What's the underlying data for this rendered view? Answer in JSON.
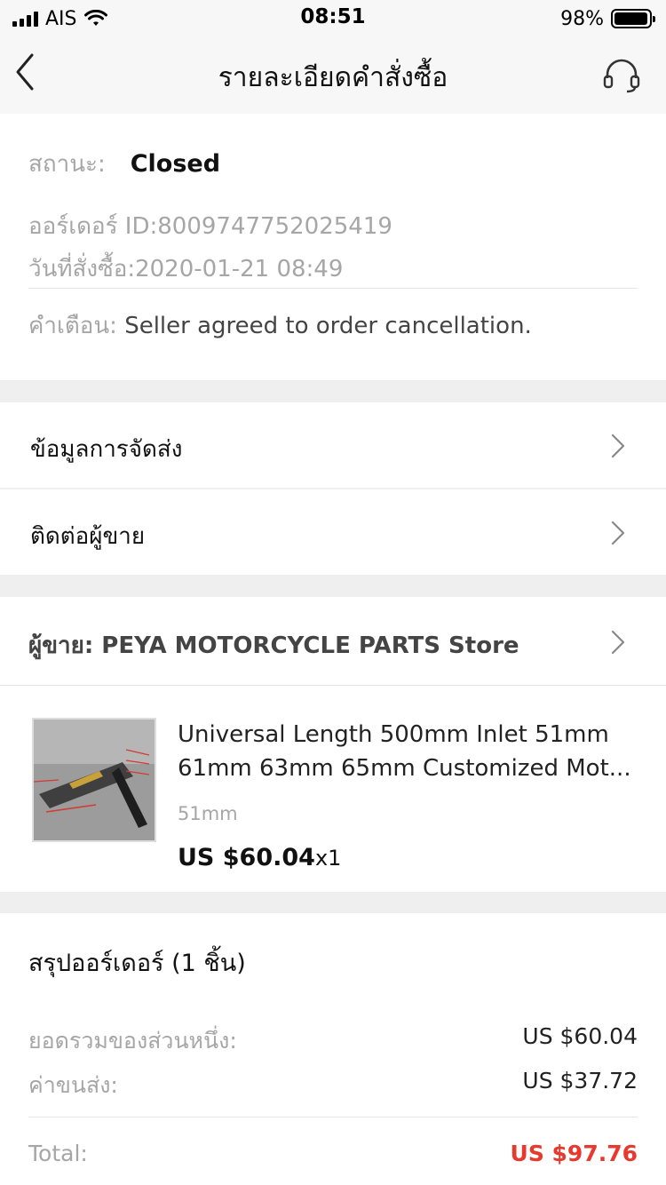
{
  "status_bar": {
    "carrier": "AIS",
    "time": "08:51",
    "battery": "98%",
    "battery_level": 0.98
  },
  "nav": {
    "title": "รายละเอียดคำสั่งซื้อ",
    "back_icon": "chevron-left-icon",
    "support_icon": "headset-icon"
  },
  "order": {
    "status_label": "สถานะ:",
    "status_value": "Closed",
    "order_id_line": "ออร์เดอร์ ID:8009747752025419",
    "order_date_line": "วันที่สั่งซื้อ:2020-01-21 08:49",
    "notice_label": "คำเตือน:",
    "notice_value": "Seller agreed to order cancellation."
  },
  "links": {
    "shipping": "ข้อมูลการจัดส่ง",
    "contact_seller": "ติดต่อผู้ขาย"
  },
  "seller": {
    "label": "ผู้ขาย: PEYA MOTORCYCLE PARTS Store"
  },
  "product": {
    "title_line1": "Universal Length 500mm Inlet 51mm",
    "title_line2": "61mm 63mm 65mm Customized Mot...",
    "variant": "51mm",
    "price": "US $60.04",
    "qty": "x1"
  },
  "summary": {
    "title": "สรุปออร์เดอร์ (1 ชิ้น)",
    "subtotal_label": "ยอดรวมของส่วนหนึ่ง:",
    "subtotal_value": "US $60.04",
    "shipping_label": "ค่าขนส่ง:",
    "shipping_value": "US $37.72",
    "total_label": "Total:",
    "total_value": "US $97.76"
  },
  "colors": {
    "accent_red": "#e8392f",
    "background": "#efefef"
  }
}
